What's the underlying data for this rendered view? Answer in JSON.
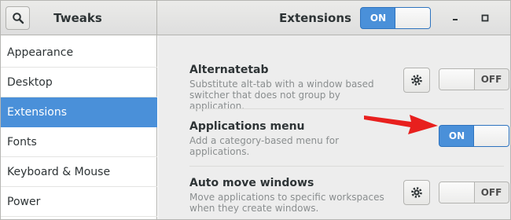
{
  "header": {
    "app_title": "Tweaks",
    "page_title": "Extensions",
    "extensions_switch": {
      "label": "ON",
      "state": "on"
    },
    "window_controls": [
      "minimize-icon",
      "maximize-icon"
    ]
  },
  "sidebar": {
    "items": [
      {
        "label": "Appearance",
        "active": false
      },
      {
        "label": "Desktop",
        "active": false
      },
      {
        "label": "Extensions",
        "active": true
      },
      {
        "label": "Fonts",
        "active": false
      },
      {
        "label": "Keyboard & Mouse",
        "active": false
      },
      {
        "label": "Power",
        "active": false
      }
    ]
  },
  "extensions": [
    {
      "title": "Alternatetab",
      "description": "Substitute alt-tab with a window based switcher that does not group by application.",
      "has_settings": true,
      "switch_label": "OFF",
      "state": "off"
    },
    {
      "title": "Applications menu",
      "description": "Add a category-based menu for applications.",
      "has_settings": false,
      "switch_label": "ON",
      "state": "on"
    },
    {
      "title": "Auto move windows",
      "description": "Move applications to specific workspaces when they create windows.",
      "has_settings": true,
      "switch_label": "OFF",
      "state": "off"
    }
  ],
  "colors": {
    "accent": "#4a90d9",
    "annotation_arrow": "#e8201e"
  }
}
